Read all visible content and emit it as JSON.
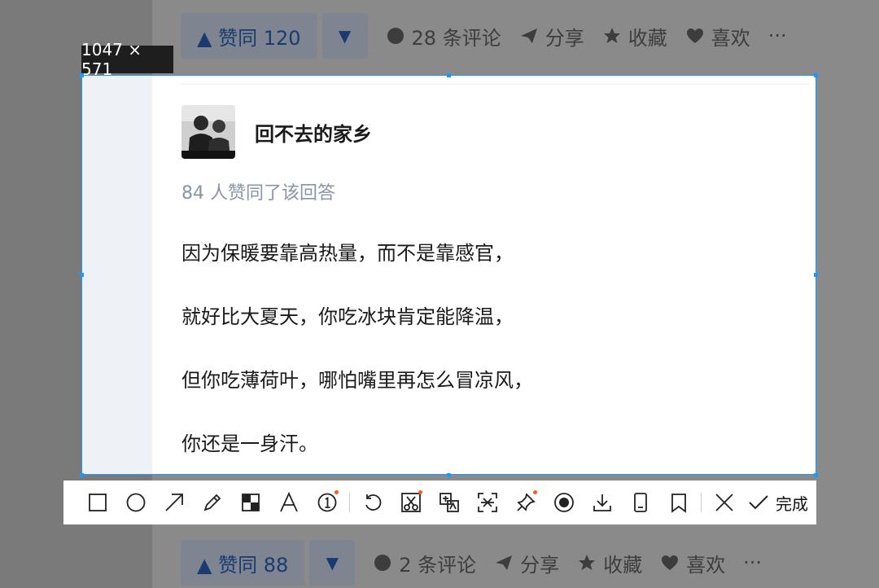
{
  "top_actions": {
    "vote_up": "▲ 赞同 120",
    "vote_down": "▼",
    "comments": "28 条评论",
    "share": "分享",
    "favorite": "收藏",
    "like": "喜欢",
    "more": "···"
  },
  "selection": {
    "dimensions": "1047 × 571"
  },
  "answer": {
    "author": "回不去的家乡",
    "upvote_note": "84 人赞同了该回答",
    "paragraphs": [
      "因为保暖要靠高热量，而不是靠感官，",
      "就好比大夏天，你吃冰块肯定能降温，",
      "但你吃薄荷叶，哪怕嘴里再怎么冒凉风，",
      "你还是一身汗。"
    ]
  },
  "toolbar": {
    "tools": [
      "rectangle-icon",
      "ellipse-icon",
      "arrow-icon",
      "pencil-icon",
      "mosaic-icon",
      "text-icon",
      "number-icon",
      "undo-icon",
      "cut-icon",
      "translate-icon",
      "ocr-icon",
      "pin-icon",
      "record-icon",
      "download-icon",
      "long-screenshot-icon",
      "bookmark-icon",
      "close-icon"
    ],
    "done_label": "完成"
  },
  "bottom_actions": {
    "vote_up": "▲ 赞同 88",
    "vote_down": "▼",
    "comments": "2 条评论",
    "share": "分享",
    "favorite": "收藏",
    "like": "喜欢",
    "more": "···"
  }
}
